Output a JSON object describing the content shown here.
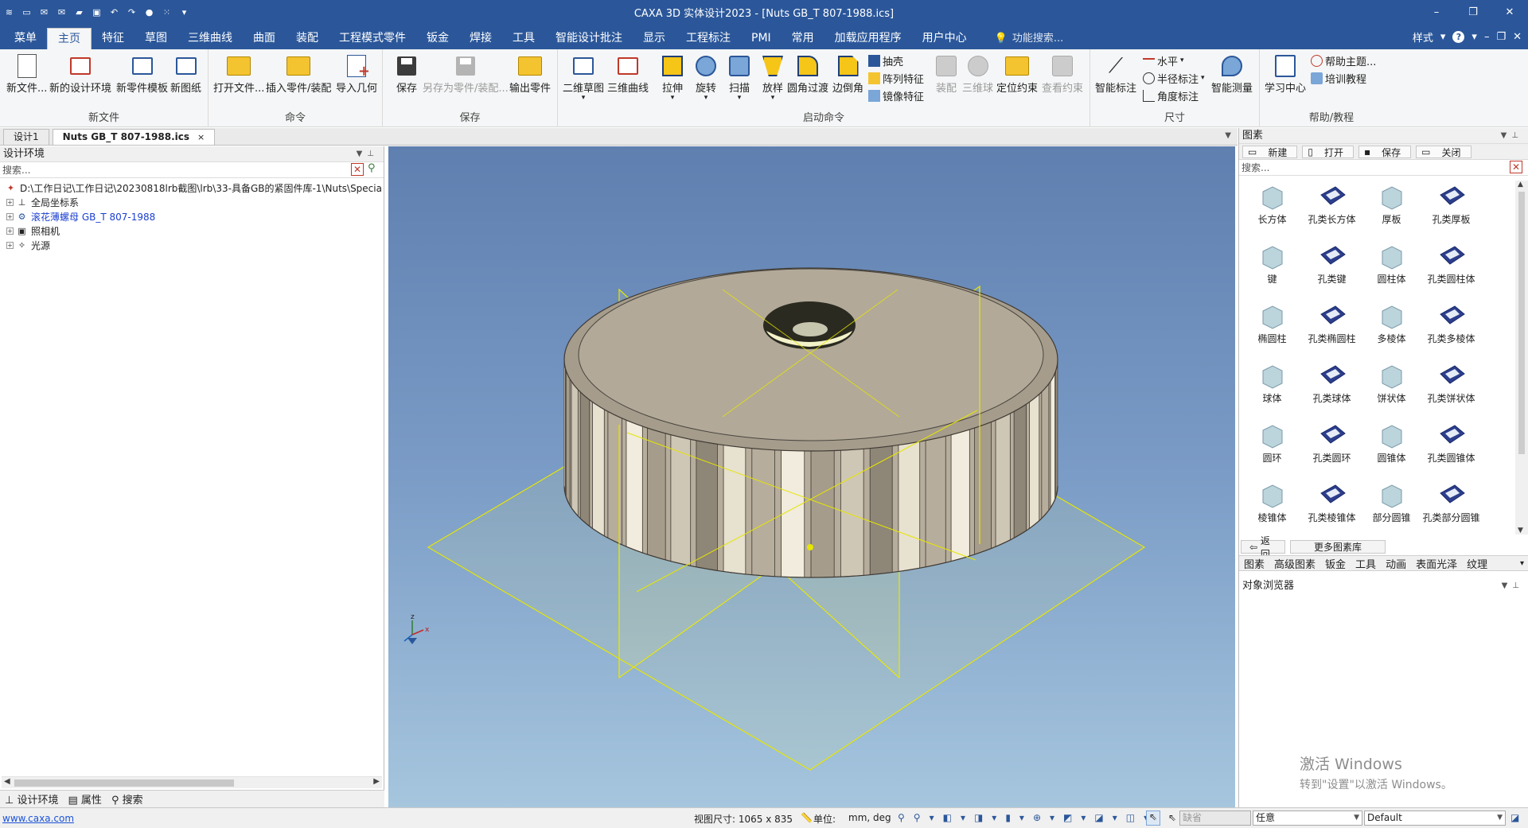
{
  "titlebar": {
    "title": "CAXA 3D 实体设计2023 - [Nuts GB_T 807-1988.ics]",
    "minimize": "–",
    "restore": "❐",
    "close": "✕"
  },
  "menu_tabs": [
    "菜单",
    "主页",
    "特征",
    "草图",
    "三维曲线",
    "曲面",
    "装配",
    "工程模式零件",
    "钣金",
    "焊接",
    "工具",
    "智能设计批注",
    "显示",
    "工程标注",
    "PMI",
    "常用",
    "加载应用程序",
    "用户中心"
  ],
  "active_tab_index": 1,
  "feature_search": "功能搜索...",
  "menubar_right": {
    "style": "样式",
    "help": "?"
  },
  "ribbon": {
    "groups": {
      "new_file": "新文件",
      "command": "命令",
      "save": "保存",
      "launch": "启动命令",
      "dimension": "尺寸",
      "help": "帮助/教程"
    },
    "buttons": {
      "new_file": "新文件...",
      "new_design_env": "新的设计环境",
      "new_part_template": "新零件模板",
      "new_drawing": "新图纸",
      "open_file": "打开文件...",
      "insert_part": "插入零件/装配",
      "import_geometry": "导入几何",
      "save": "保存",
      "save_as_part": "另存为零件/装配...",
      "export_part": "输出零件",
      "sketch_2d": "二维草图",
      "curve_3d": "三维曲线",
      "extrude": "拉伸",
      "revolve": "旋转",
      "sweep": "扫描",
      "loft": "放样",
      "fillet": "圆角过渡",
      "chamfer": "边倒角",
      "shell": "抽壳",
      "pattern": "阵列特征",
      "mirror": "镜像特征",
      "assembly": "装配",
      "ball_3d": "三维球",
      "position_constraint": "定位约束",
      "view_constraint": "查看约束",
      "smart_dim": "智能标注",
      "horizontal": "水平",
      "radius_dim": "半径标注",
      "angle_dim": "角度标注",
      "smart_measure": "智能测量",
      "learning_center": "学习中心",
      "help_topics": "帮助主题...",
      "training": "培训教程"
    }
  },
  "doc_tabs": [
    {
      "label": "设计1"
    },
    {
      "label": "Nuts GB_T 807-1988.ics",
      "close": "×"
    }
  ],
  "left_panel": {
    "title": "设计环境",
    "search_placeholder": "搜索...",
    "tree": [
      {
        "label": "D:\\工作日记\\工作日记\\20230818lrb截图\\lrb\\33-具备GB的紧固件库-1\\Nuts\\Specia"
      },
      {
        "label": "全局坐标系"
      },
      {
        "label": "滚花薄螺母 GB_T 807-1988"
      },
      {
        "label": "照相机"
      },
      {
        "label": "光源"
      }
    ],
    "bottom_tabs": [
      "设计环境",
      "属性",
      "搜索"
    ]
  },
  "right_panel": {
    "title": "图素",
    "toolbar": [
      "新建",
      "打开",
      "保存",
      "关闭"
    ],
    "search_placeholder": "搜索...",
    "shapes": [
      {
        "label": "长方体",
        "icon": "box-icon"
      },
      {
        "label": "孔类长方体",
        "icon": "hole-box-icon"
      },
      {
        "label": "厚板",
        "icon": "plate-icon"
      },
      {
        "label": "孔类厚板",
        "icon": "hole-plate-icon"
      },
      {
        "label": "键",
        "icon": "key-icon"
      },
      {
        "label": "孔类键",
        "icon": "hole-key-icon"
      },
      {
        "label": "圆柱体",
        "icon": "cylinder-icon"
      },
      {
        "label": "孔类圆柱体",
        "icon": "hole-cylinder-icon"
      },
      {
        "label": "椭圆柱",
        "icon": "elliptic-cylinder-icon"
      },
      {
        "label": "孔类椭圆柱",
        "icon": "hole-elliptic-cylinder-icon"
      },
      {
        "label": "多棱体",
        "icon": "prism-icon"
      },
      {
        "label": "孔类多棱体",
        "icon": "hole-prism-icon"
      },
      {
        "label": "球体",
        "icon": "sphere-icon"
      },
      {
        "label": "孔类球体",
        "icon": "hole-sphere-icon"
      },
      {
        "label": "饼状体",
        "icon": "pie-icon"
      },
      {
        "label": "孔类饼状体",
        "icon": "hole-pie-icon"
      },
      {
        "label": "圆环",
        "icon": "torus-icon"
      },
      {
        "label": "孔类圆环",
        "icon": "hole-torus-icon"
      },
      {
        "label": "圆锥体",
        "icon": "cone-icon"
      },
      {
        "label": "孔类圆锥体",
        "icon": "hole-cone-icon"
      },
      {
        "label": "棱锥体",
        "icon": "pyramid-icon"
      },
      {
        "label": "孔类棱锥体",
        "icon": "hole-pyramid-icon"
      },
      {
        "label": "部分圆锥",
        "icon": "partial-cone-icon"
      },
      {
        "label": "孔类部分圆锥",
        "icon": "hole-partial-cone-icon"
      }
    ],
    "nav_back": "返回",
    "nav_more": "更多图素库",
    "bottom_tabs": [
      "图素",
      "高级图素",
      "钣金",
      "工具",
      "动画",
      "表面光泽",
      "纹理"
    ],
    "object_browser": "对象浏览器"
  },
  "axis_labels": {
    "z": "z",
    "x": "x"
  },
  "watermark": {
    "line1": "激活 Windows",
    "line2": "转到\"设置\"以激活 Windows。"
  },
  "statusbar": {
    "link": "www.caxa.com",
    "view_size": "视图尺寸: 1065 x  835",
    "unit_label": "单位:",
    "unit_value": "mm, deg",
    "box1": "缺省",
    "box2": "任意",
    "box3": "Default"
  },
  "colors": {
    "accent": "#2b579a",
    "part": "#b5ab9a",
    "plane_outline": "#e6e600"
  }
}
